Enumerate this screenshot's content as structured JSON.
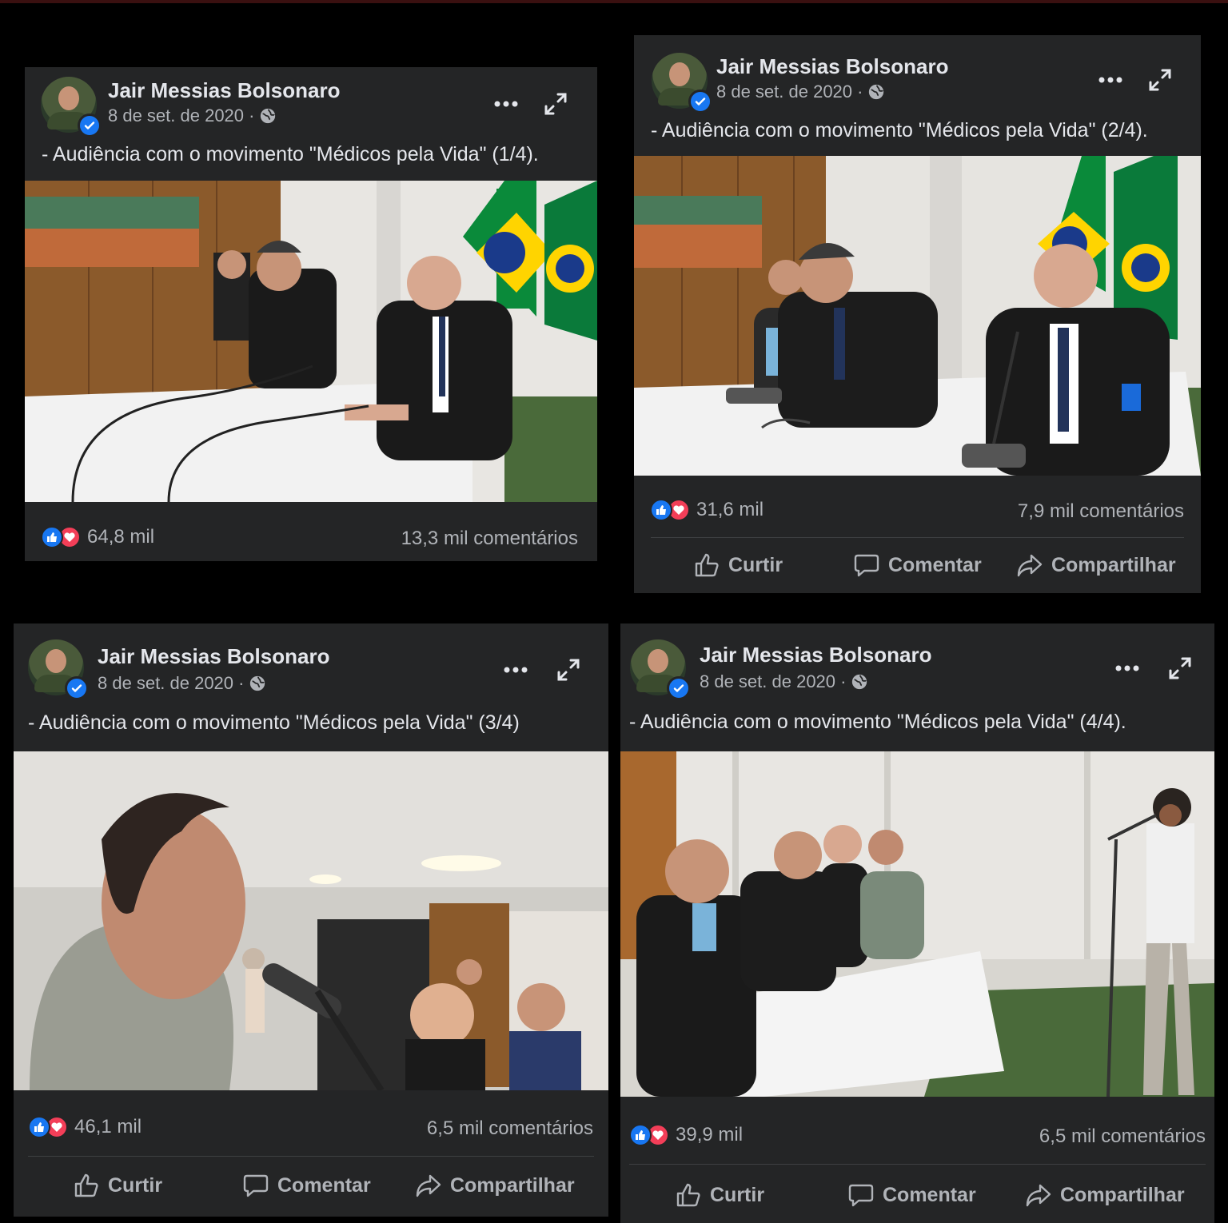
{
  "posts": [
    {
      "author": "Jair Messias Bolsonaro",
      "date": "8 de set. de 2020 ·",
      "caption": "- Audiência com o movimento \"Médicos pela Vida\" (1/4).",
      "reaction_count": "64,8 mil",
      "comments": "13,3 mil comentários"
    },
    {
      "author": "Jair Messias Bolsonaro",
      "date": "8 de set. de 2020 ·",
      "caption": "- Audiência com o movimento \"Médicos pela Vida\" (2/4).",
      "reaction_count": "31,6 mil",
      "comments": "7,9 mil comentários",
      "actions": {
        "like": "Curtir",
        "comment": "Comentar",
        "share": "Compartilhar"
      }
    },
    {
      "author": "Jair Messias Bolsonaro",
      "date": "8 de set. de 2020 ·",
      "caption": "- Audiência com o movimento \"Médicos pela Vida\" (3/4)",
      "reaction_count": "46,1 mil",
      "comments": "6,5 mil comentários",
      "actions": {
        "like": "Curtir",
        "comment": "Comentar",
        "share": "Compartilhar"
      }
    },
    {
      "author": "Jair Messias Bolsonaro",
      "date": "8 de set. de 2020 ·",
      "caption": "- Audiência com o movimento \"Médicos pela Vida\" (4/4).",
      "reaction_count": "39,9 mil",
      "comments": "6,5 mil comentários",
      "actions": {
        "like": "Curtir",
        "comment": "Comentar",
        "share": "Compartilhar"
      }
    }
  ],
  "icons": {
    "more": "more-options-icon",
    "expand": "expand-icon",
    "audience": "globe-icon",
    "verified": "verified-badge-icon",
    "like": "thumbs-up-icon",
    "love": "heart-icon",
    "comment": "comment-bubble-icon",
    "share": "share-arrow-icon"
  },
  "colors": {
    "card": "#242526",
    "background": "#000000",
    "text": "#e4e6eb",
    "secondary_text": "#b0b3b8",
    "like_blue": "#1877f2",
    "love_red": "#f33e58"
  }
}
